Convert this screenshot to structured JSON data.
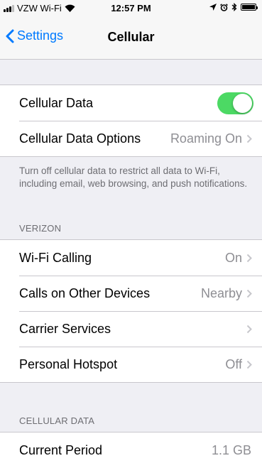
{
  "status_bar": {
    "carrier": "VZW Wi-Fi",
    "time": "12:57 PM"
  },
  "nav": {
    "back_label": "Settings",
    "title": "Cellular"
  },
  "cellular_section": {
    "cellular_data_label": "Cellular Data",
    "cellular_data_enabled": true,
    "toggle_color": "#4cd964",
    "options_label": "Cellular Data Options",
    "options_value": "Roaming On"
  },
  "footer_note": "Turn off cellular data to restrict all data to Wi-Fi, including email, web browsing, and push notifications.",
  "verizon_section": {
    "header": "VERIZON",
    "items": [
      {
        "label": "Wi-Fi Calling",
        "value": "On"
      },
      {
        "label": "Calls on Other Devices",
        "value": "Nearby"
      },
      {
        "label": "Carrier Services",
        "value": ""
      },
      {
        "label": "Personal Hotspot",
        "value": "Off"
      }
    ]
  },
  "usage_section": {
    "header": "CELLULAR DATA",
    "current_period_label": "Current Period",
    "current_period_value": "1.1 GB"
  },
  "colors": {
    "accent": "#007aff",
    "secondary_text": "#8e8e93",
    "background": "#efeff4"
  }
}
